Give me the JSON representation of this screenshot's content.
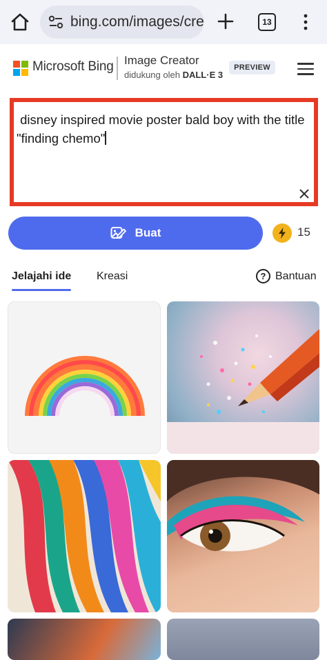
{
  "browser": {
    "url": "bing.com/images/create",
    "tab_count": "13"
  },
  "header": {
    "brand": "Microsoft Bing",
    "product_title": "Image Creator",
    "powered_by_prefix": "didukung oleh",
    "powered_by_model": "DALL·E 3",
    "badge": "PREVIEW"
  },
  "prompt": {
    "value": "disney inspired movie poster bald boy with the title \"finding chemo\""
  },
  "create": {
    "label": "Buat",
    "boost_count": "15"
  },
  "tabs": {
    "explore": "Jelajahi ide",
    "creations": "Kreasi",
    "help": "Bantuan"
  },
  "colors": {
    "accent": "#4f6bed",
    "highlight_border": "#e63a24",
    "boost": "#f2b21c"
  },
  "gallery": [
    {
      "name": "rainbow-paper-image"
    },
    {
      "name": "colored-pencil-glitter-image"
    },
    {
      "name": "colorful-ribbons-image"
    },
    {
      "name": "eye-makeup-image"
    },
    {
      "name": "feather-image"
    },
    {
      "name": "splash-image"
    }
  ]
}
